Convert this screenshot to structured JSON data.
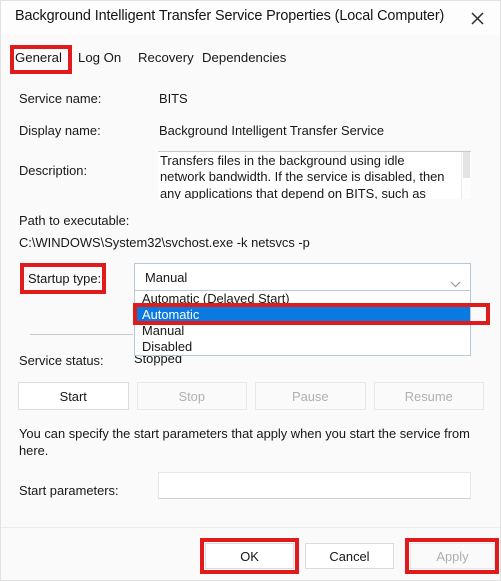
{
  "window": {
    "title": "Background Intelligent Transfer Service Properties (Local Computer)",
    "close_icon": "close-icon"
  },
  "tabs": [
    {
      "label": "General",
      "active": true
    },
    {
      "label": "Log On",
      "active": false
    },
    {
      "label": "Recovery",
      "active": false
    },
    {
      "label": "Dependencies",
      "active": false
    }
  ],
  "fields": {
    "service_name_label": "Service name:",
    "service_name_value": "BITS",
    "display_name_label": "Display name:",
    "display_name_value": "Background Intelligent Transfer Service",
    "description_label": "Description:",
    "description_value": "Transfers files in the background using idle network bandwidth. If the service is disabled, then any applications that depend on BITS, such as Windows",
    "path_label": "Path to executable:",
    "path_value": "C:\\WINDOWS\\System32\\svchost.exe -k netsvcs -p",
    "startup_type_label": "Startup type:",
    "startup_type_value": "Manual",
    "service_status_label": "Service status:",
    "service_status_value": "Stopped",
    "start_parameters_label": "Start parameters:",
    "start_parameters_value": "",
    "start_parameters_placeholder": ""
  },
  "startup_dropdown": {
    "open": true,
    "selected": "Automatic",
    "options": [
      "Automatic (Delayed Start)",
      "Automatic",
      "Manual",
      "Disabled"
    ],
    "chevron_icon": "chevron-down-icon",
    "highlight_color": "#0a7ae0"
  },
  "control_buttons": [
    {
      "label": "Start",
      "disabled": false
    },
    {
      "label": "Stop",
      "disabled": true
    },
    {
      "label": "Pause",
      "disabled": true
    },
    {
      "label": "Resume",
      "disabled": true
    }
  ],
  "help_text": "You can specify the start parameters that apply when you start the service from here.",
  "footer_buttons": {
    "ok": "OK",
    "cancel": "Cancel",
    "apply": "Apply",
    "apply_disabled": true
  },
  "annotations": {
    "color": "#e01b1b",
    "targets": [
      "General tab",
      "Startup type label",
      "Automatic option",
      "OK button",
      "Apply button"
    ]
  }
}
